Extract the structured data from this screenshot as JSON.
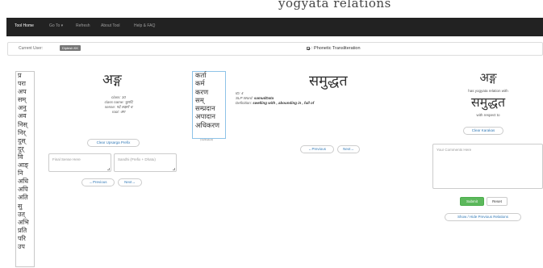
{
  "app_title": "yogyata relations",
  "navbar": {
    "items": [
      "Tool Home",
      "Go To ▾",
      "Refresh",
      "About Tool",
      "Help & FAQ"
    ]
  },
  "user_panel": {
    "label": "Current User:",
    "user_badge": "Diptesh KK",
    "phonetic_label": ": Phonetic Transliteration",
    "phonetic_checked": true
  },
  "prefixes": [
    "प्र",
    "परा",
    "अप",
    "सम्",
    "अनु",
    "अव",
    "निस्",
    "निर्",
    "दुस्",
    "दुर्",
    "वि",
    "आङ्",
    "नि",
    "अधि",
    "अपि",
    "अति",
    "सु",
    "उत्",
    "अभि",
    "प्रति",
    "परि",
    "उप"
  ],
  "left_word": {
    "word": "अङ्ग",
    "class_line": "class: 10",
    "class_name_line": "class name: चुरादि",
    "sense_line": "sense: पदे लक्षणे च",
    "root_line": "root: अंग",
    "clear_upasarga_label": "Clear Upsarga Prefix",
    "final_sense_placeholder": "Final Sense Here",
    "sandhi_placeholder": "Sandhi (Prefix + Dhatu)",
    "prev_label": "←Previous",
    "next_label": "Next→"
  },
  "karakas": {
    "items": [
      "कर्ता",
      "कर्म",
      "करण",
      "सम्",
      "सम्प्रदान",
      "अपादान",
      "अधिकरण"
    ],
    "multiselect_label": "(multiselect)"
  },
  "middle_word": {
    "word": "समुद्धत",
    "id_label": "ID:",
    "id_value": "4",
    "slp_label": "SLP Word:",
    "slp_value": "samudData",
    "definition_label": "Definition:",
    "definition_value": "swelling with , abounding in , full of",
    "prev_label": "←Previous",
    "next_label": "Next→"
  },
  "right_panel": {
    "word1": "अङ्ग",
    "relation_text": "has yogyata relation with",
    "word2": "समुद्धत",
    "respect_text": "with respect to",
    "clear_karakas_label": "Clear Karakas",
    "comments_placeholder": "Your Comments Here",
    "submit_label": "Submit",
    "reset_label": "Reset",
    "show_hide_label": "Show / Hide Previous Relations"
  },
  "colors": {
    "navbar_bg": "#222222",
    "link": "#337ab7",
    "success": "#5cb85c",
    "badge": "#777777",
    "karaka_border": "#8ec3e8"
  }
}
